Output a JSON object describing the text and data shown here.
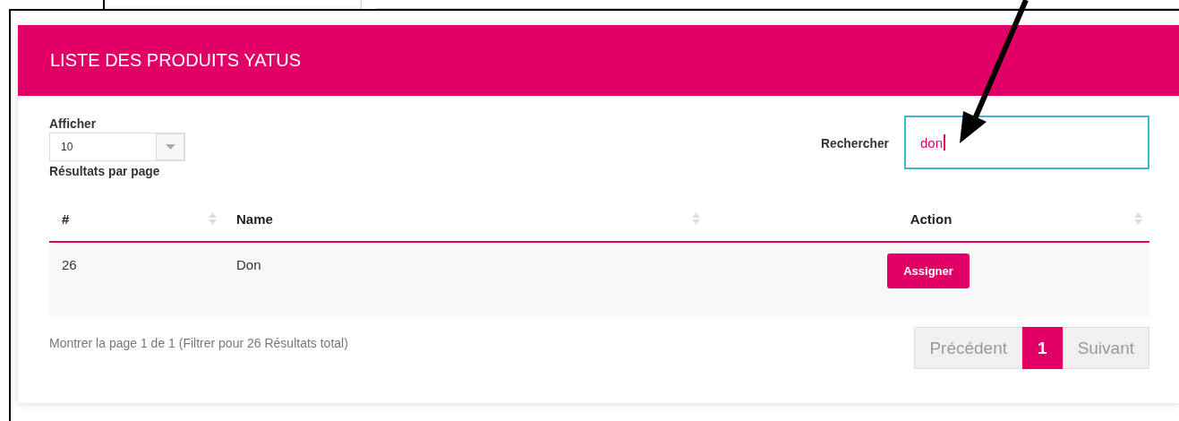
{
  "panel": {
    "title": "LISTE DES PRODUITS YATUS"
  },
  "length": {
    "label": "Afficher",
    "value": "10",
    "suffix": "Résultats par page"
  },
  "search": {
    "label": "Rechercher",
    "value": "don"
  },
  "table": {
    "columns": [
      {
        "label": "#"
      },
      {
        "label": "Name"
      },
      {
        "label": "Action"
      }
    ],
    "rows": [
      {
        "cells": [
          "26",
          "Don"
        ],
        "action": "Assigner"
      }
    ]
  },
  "info": "Montrer la page 1 de 1 (Filtrer pour 26 Résultats total)",
  "pagination": [
    {
      "label": "Précédent",
      "selected": false
    },
    {
      "label": "1",
      "selected": true
    },
    {
      "label": "Suivant",
      "selected": false
    }
  ]
}
